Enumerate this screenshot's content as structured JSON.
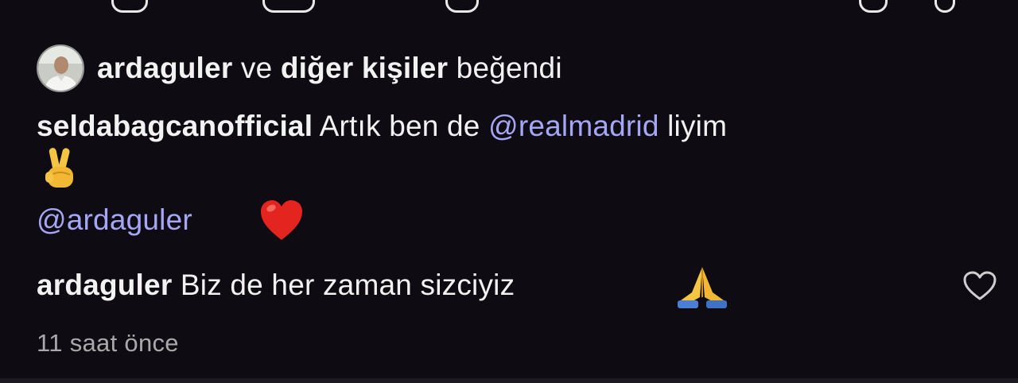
{
  "likes": {
    "user": "ardaguler",
    "connector": "ve",
    "others": "diğer kişiler",
    "verb": "beğendi"
  },
  "caption": {
    "author": "seldabagcanofficial",
    "text_before": "Artık ben de",
    "mention_club": "@realmadrid",
    "text_after": "liyim",
    "emoji_1": "victory-hand-emoji",
    "mention_user": "@ardaguler",
    "emoji_2": "red-heart-emoji"
  },
  "comment": {
    "author": "ardaguler",
    "text": "Biz de her zaman sizciyiz",
    "emoji": "folded-hands-emoji",
    "timestamp": "11 saat önce",
    "like_icon": "heart-outline-icon"
  },
  "colors": {
    "background": "#0e0c12",
    "text": "#f2f2f2",
    "mention": "#a6a6f6",
    "muted": "#a9a9a9"
  }
}
